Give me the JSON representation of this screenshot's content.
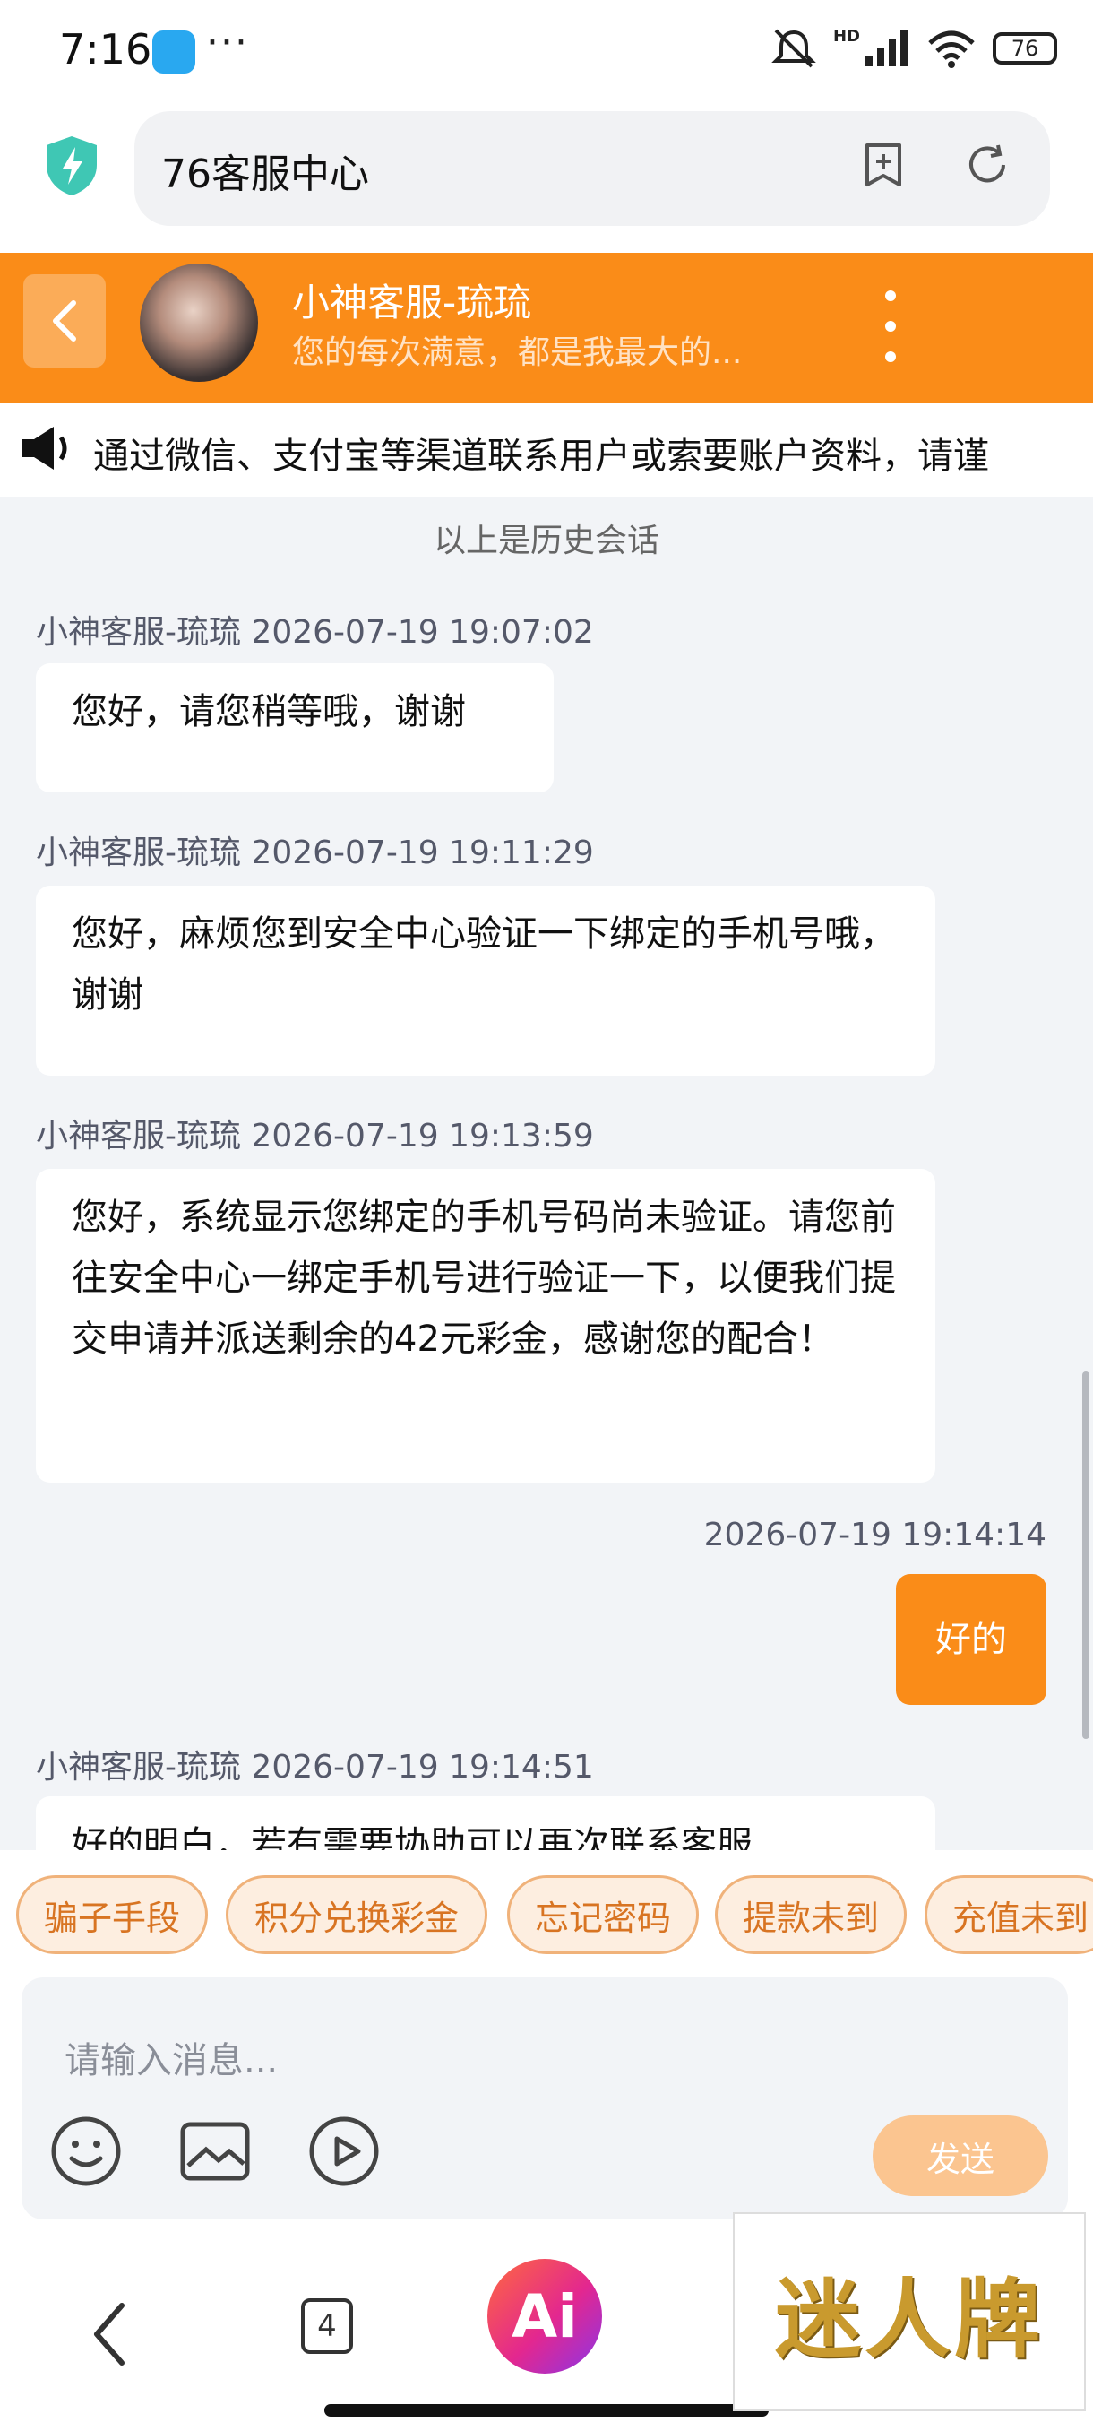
{
  "status_bar": {
    "time": "7:16",
    "more": "···",
    "battery": "76",
    "network": "HD"
  },
  "browser": {
    "title": "76客服中心"
  },
  "chat_header": {
    "agent_name": "小神客服-琉琉",
    "agent_subtitle": "您的每次满意，都是我最大的..."
  },
  "notice": {
    "text": "通过微信、支付宝等渠道联系用户或索要账户资料，请谨"
  },
  "chat": {
    "history_label": "以上是历史会话",
    "messages": [
      {
        "meta": "小神客服-琉琉 2026-07-19 19:07:02",
        "text": "您好，请您稍等哦，谢谢"
      },
      {
        "meta": "小神客服-琉琉 2026-07-19 19:11:29",
        "text": "您好，麻烦您到安全中心验证一下绑定的手机号哦，谢谢"
      },
      {
        "meta": "小神客服-琉琉 2026-07-19 19:13:59",
        "text": "您好，系统显示您绑定的手机号码尚未验证。请您前往安全中心一绑定手机号进行验证一下，以便我们提交申请并派送剩余的42元彩金，感谢您的配合！"
      },
      {
        "meta": "2026-07-19 19:14:14",
        "text": "好的"
      },
      {
        "meta": "小神客服-琉琉 2026-07-19 19:14:51",
        "text": "好的明白，若有需要协助可以再次联系客服"
      }
    ]
  },
  "quick_replies": [
    "骗子手段",
    "积分兑换彩金",
    "忘记密码",
    "提款未到",
    "充值未到"
  ],
  "input": {
    "placeholder": "请输入消息...",
    "send_label": "发送"
  },
  "nav": {
    "tab_count": "4",
    "ai_label": "Ai"
  },
  "watermark": {
    "text": "迷人牌"
  },
  "colors": {
    "brand_orange": "#fa8c18",
    "chat_bg": "#f2f4f7",
    "chip_text": "#d87422"
  }
}
